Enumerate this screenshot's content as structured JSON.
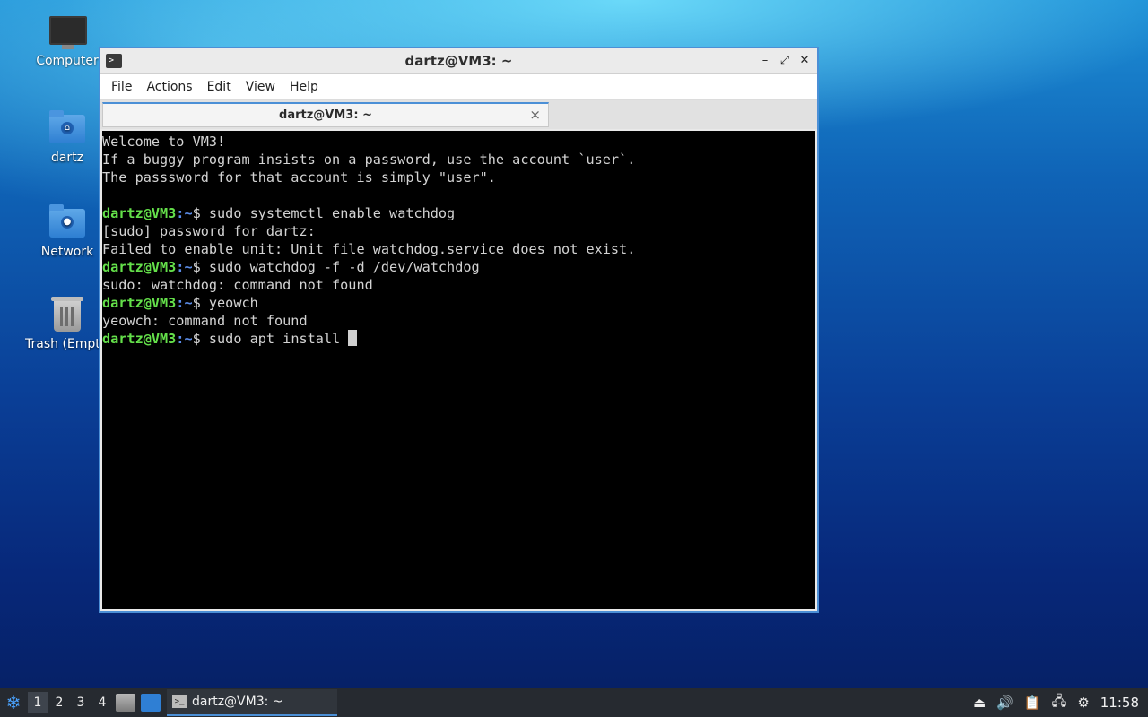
{
  "desktop": {
    "icons": [
      {
        "label": "Computer",
        "icon": "computer-icon"
      },
      {
        "label": "dartz",
        "icon": "home-folder-icon"
      },
      {
        "label": "Network",
        "icon": "network-folder-icon"
      },
      {
        "label": "Trash (Empt",
        "icon": "trash-icon"
      }
    ]
  },
  "window": {
    "title": "dartz@VM3: ~",
    "controls": {
      "minimize": "–",
      "maximize": "⤢",
      "close": "✕"
    },
    "menu": [
      "File",
      "Actions",
      "Edit",
      "View",
      "Help"
    ],
    "tab": {
      "label": "dartz@VM3: ~",
      "close": "×"
    }
  },
  "terminal": {
    "prompt_user": "dartz@VM3",
    "prompt_path": ":~",
    "prompt_symbol": "$ ",
    "lines": [
      {
        "text": "Welcome to VM3!"
      },
      {
        "text": "If a buggy program insists on a password, use the account `user`."
      },
      {
        "text": "The passsword for that account is simply \"user\"."
      },
      {
        "text": ""
      },
      {
        "prompt": true,
        "text": "sudo systemctl enable watchdog"
      },
      {
        "text": "[sudo] password for dartz:"
      },
      {
        "text": "Failed to enable unit: Unit file watchdog.service does not exist."
      },
      {
        "prompt": true,
        "text": "sudo watchdog -f -d /dev/watchdog"
      },
      {
        "text": "sudo: watchdog: command not found"
      },
      {
        "prompt": true,
        "text": "yeowch"
      },
      {
        "text": "yeowch: command not found"
      },
      {
        "prompt": true,
        "text": "sudo apt install ",
        "cursor": true
      }
    ]
  },
  "taskbar": {
    "workspaces": [
      "1",
      "2",
      "3",
      "4"
    ],
    "active_workspace": "1",
    "task_label": "dartz@VM3: ~",
    "clock": "11:58",
    "tray_icons": [
      "eject-icon",
      "volume-icon",
      "clipboard-icon",
      "network-icon",
      "updates-icon"
    ]
  },
  "colors": {
    "prompt_user": "#64e04a",
    "prompt_path": "#5b8ce8",
    "accent": "#4b8fd6"
  }
}
